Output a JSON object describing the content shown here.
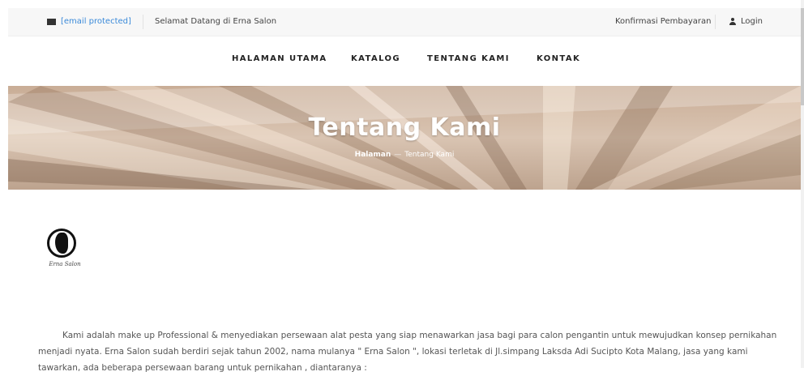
{
  "topbar": {
    "email": "[email protected]",
    "welcome": "Selamat Datang di Erna Salon",
    "confirm_payment": "Konfirmasi Pembayaran",
    "login": "Login"
  },
  "nav": {
    "items": [
      {
        "label": "HALAMAN UTAMA"
      },
      {
        "label": "KATALOG"
      },
      {
        "label": "TENTANG KAMI"
      },
      {
        "label": "KONTAK"
      }
    ]
  },
  "hero": {
    "title": "Tentang Kami",
    "breadcrumb_home": "Halaman",
    "breadcrumb_separator": "—",
    "breadcrumb_current": "Tentang Kami"
  },
  "logo": {
    "script_text": "Erna Salon"
  },
  "about": {
    "text": "Kami adalah make up Professional & menyediakan persewaan alat pesta yang siap menawarkan jasa bagi para calon pengantin untuk mewujudkan konsep pernikahan menjadi nyata. Erna Salon sudah berdiri sejak tahun 2002, nama mulanya \" Erna Salon \", lokasi terletak di Jl.simpang Laksda Adi Sucipto Kota Malang, jasa yang kami tawarkan, ada beberapa persewaan barang untuk pernikahan , diantaranya :"
  },
  "colors": {
    "link": "#3b8ad9",
    "topbar_bg": "#f7f7f7",
    "nav_text": "#222222",
    "hero_text": "#ffffff"
  },
  "icons": {
    "email": "envelope-icon",
    "login": "user-icon"
  }
}
